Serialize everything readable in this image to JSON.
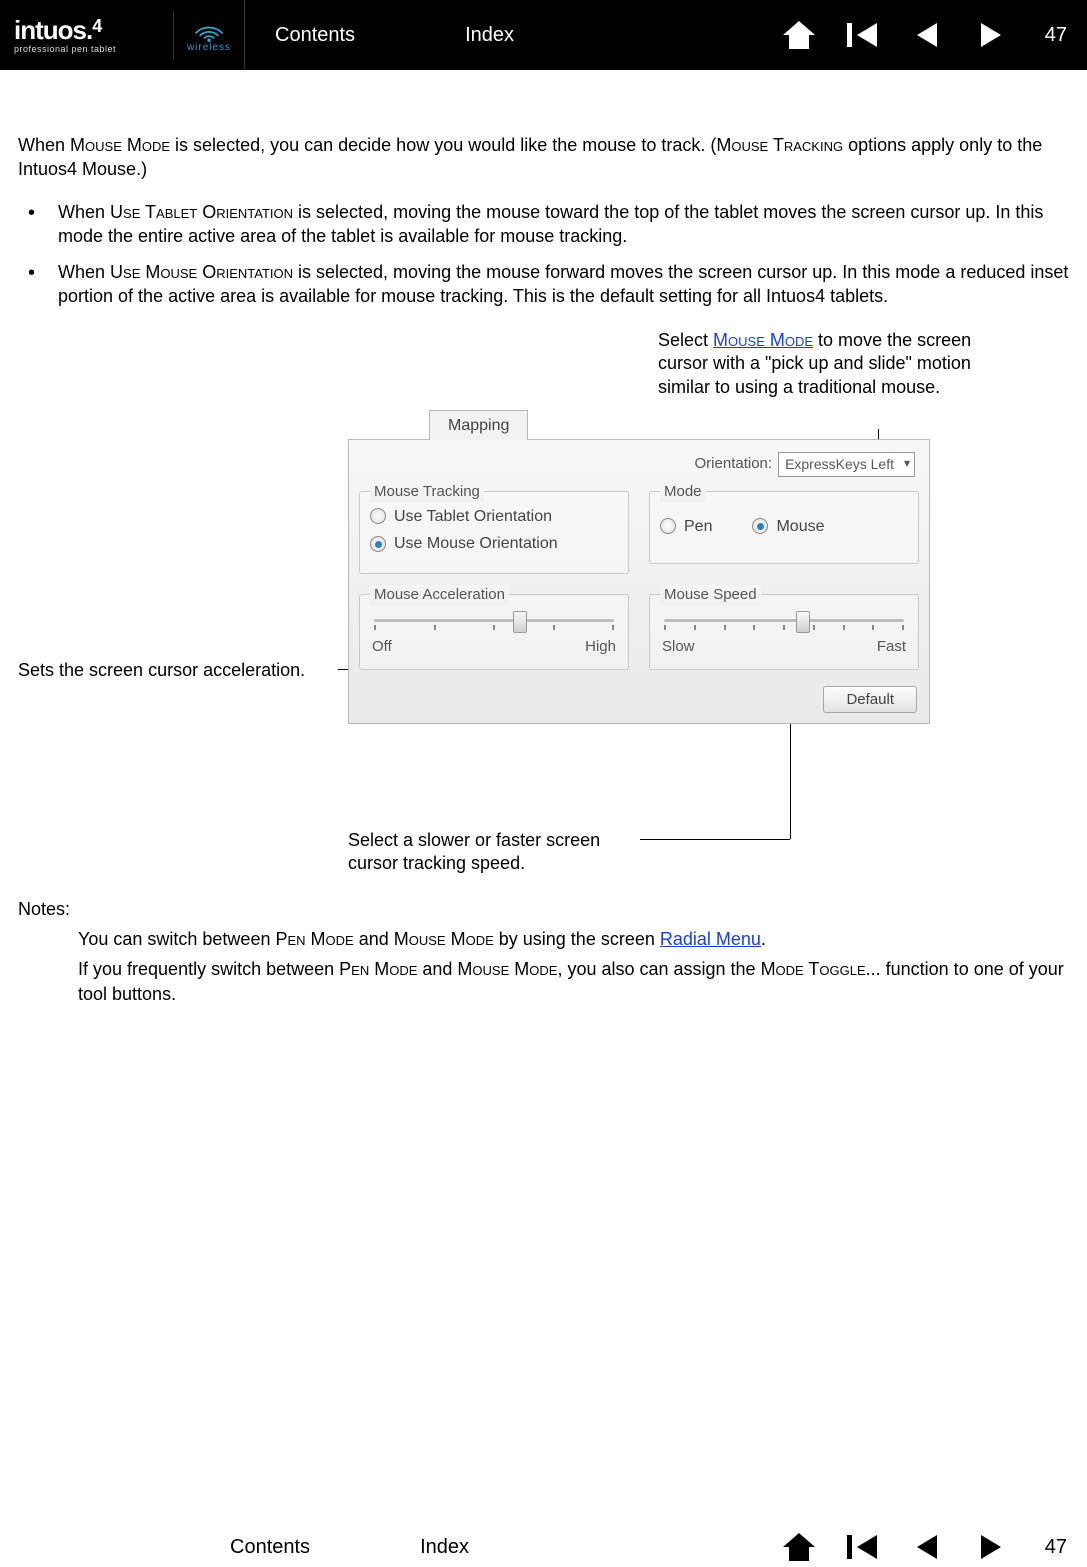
{
  "header": {
    "logo_main": "intuos.",
    "logo_suffix": "4",
    "logo_sub": "professional pen tablet",
    "wireless": "wireless",
    "contents": "Contents",
    "index": "Index",
    "page": "47"
  },
  "body": {
    "intro_pre": "When ",
    "intro_sc1": "Mouse Mode",
    "intro_mid": " is selected, you can decide how you would like the mouse to track.  (",
    "intro_sc2": "Mouse Tracking",
    "intro_post": " options apply only to the Intuos4 Mouse.)",
    "b1_pre": "When ",
    "b1_sc": "Use Tablet Orientation",
    "b1_post": " is selected, moving the mouse toward the top of the tablet moves the screen cursor up.  In this mode the entire active area of the tablet is available for mouse tracking.",
    "b2_pre": "When ",
    "b2_sc": "Use Mouse Orientation",
    "b2_post": " is selected, moving the mouse forward moves the screen cursor up.  In this mode a reduced inset portion of the active area is available for mouse tracking.  This is the default setting for all Intuos4 tablets."
  },
  "callouts": {
    "c_mouse_pre": "Select ",
    "c_mouse_link": "Mouse Mode",
    "c_mouse_post": " to move the screen cursor with a \"pick up and slide\" motion similar to using a traditional mouse.",
    "c_accel": "Sets the screen cursor acceleration.",
    "c_speed": "Select a slower or faster screen cursor tracking speed."
  },
  "dialog": {
    "tab": "Mapping",
    "orientation_label": "Orientation:",
    "orientation_value": "ExpressKeys Left",
    "tracking_title": "Mouse Tracking",
    "tracking_opt1": "Use Tablet Orientation",
    "tracking_opt2": "Use Mouse Orientation",
    "mode_title": "Mode",
    "mode_opt1": "Pen",
    "mode_opt2": "Mouse",
    "accel_title": "Mouse Acceleration",
    "accel_low": "Off",
    "accel_high": "High",
    "speed_title": "Mouse Speed",
    "speed_low": "Slow",
    "speed_high": "Fast",
    "default_btn": "Default"
  },
  "notes": {
    "heading": "Notes:",
    "n1_pre": "You can switch between ",
    "n1_sc1": "Pen Mode",
    "n1_mid": " and ",
    "n1_sc2": "Mouse Mode",
    "n1_post": " by using the screen ",
    "n1_link": "Radial Menu",
    "n1_end": ".",
    "n2_pre": "If you frequently switch between ",
    "n2_sc1": "Pen Mode",
    "n2_mid": " and ",
    "n2_sc2": "Mouse Mode",
    "n2_post": ", you also can assign the ",
    "n2_sc3": "Mode Toggle...",
    "n2_end": " function to one of your tool buttons."
  },
  "footer": {
    "contents": "Contents",
    "index": "Index",
    "page": "47"
  }
}
